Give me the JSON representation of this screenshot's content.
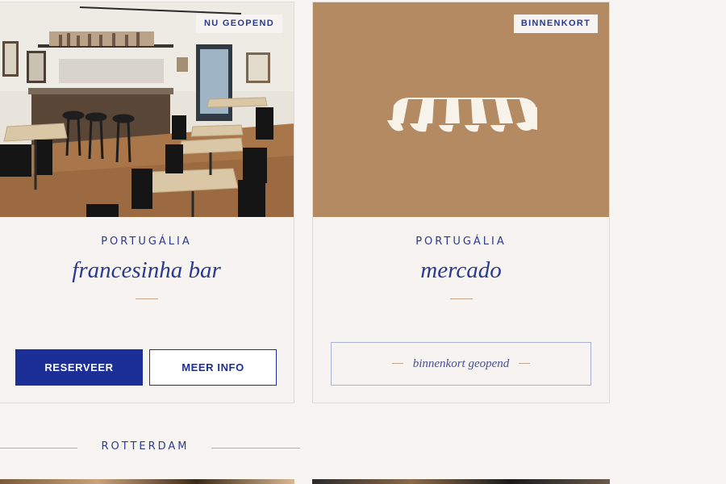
{
  "cards": [
    {
      "badge": "NU GEOPEND",
      "brand": "PORTUGÁLIA",
      "title": "francesinha bar",
      "primary_button": "RESERVEER",
      "secondary_button": "MEER INFO"
    },
    {
      "badge": "BINNENKORT",
      "brand": "PORTUGÁLIA",
      "title": "mercado",
      "status": "binnenkort geopend"
    }
  ],
  "section": {
    "city": "ROTTERDAM"
  },
  "colors": {
    "navy": "#1b2f96",
    "text_blue": "#2a3a8f",
    "accent_copper": "#c7a48a",
    "placeholder_tan": "#b38a62",
    "background": "#f8f4f1"
  },
  "icons": {
    "awning": "awning-icon"
  }
}
